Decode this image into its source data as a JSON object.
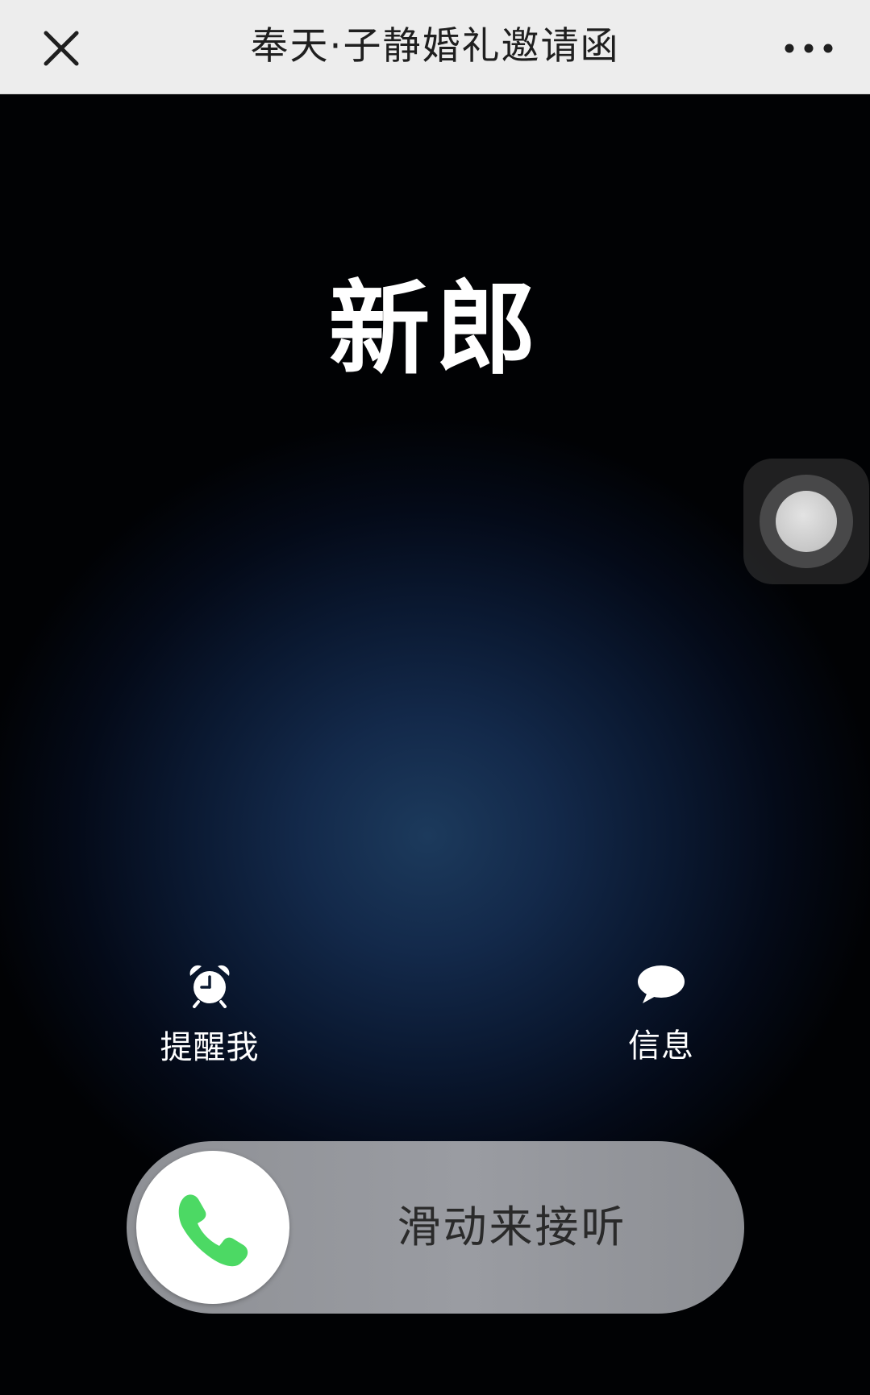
{
  "topbar": {
    "title": "奉天·子静婚礼邀请函",
    "close_icon": "close-icon",
    "more_icon": "more-horizontal-icon"
  },
  "call_screen": {
    "caller_name": "新郎",
    "actions": [
      {
        "icon": "alarm-clock-icon",
        "label": "提醒我"
      },
      {
        "icon": "message-bubble-icon",
        "label": "信息"
      }
    ],
    "slider": {
      "icon": "phone-icon",
      "label": "滑动来接听",
      "accent_color": "#4cd964"
    }
  }
}
